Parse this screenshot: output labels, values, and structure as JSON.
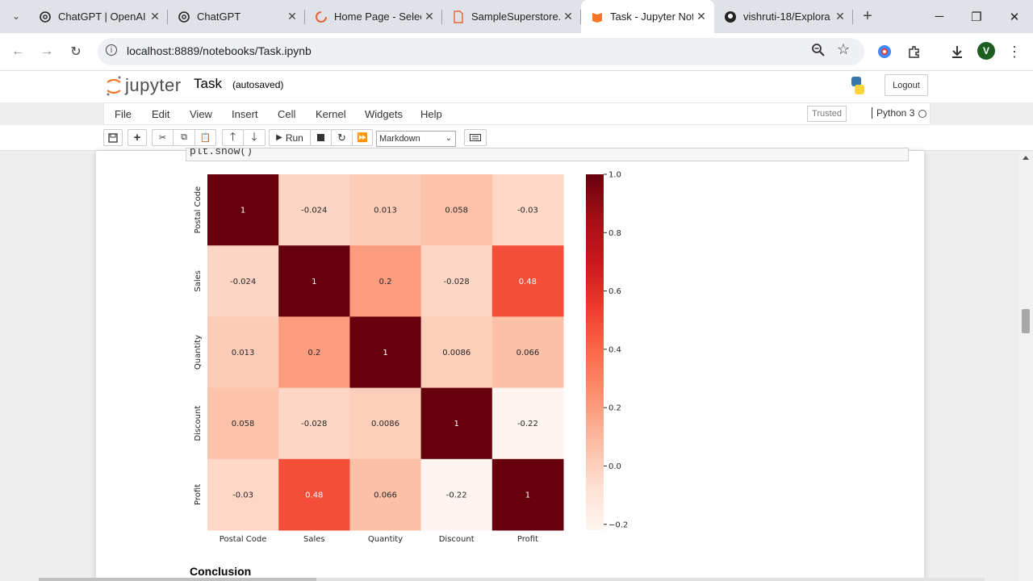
{
  "browser": {
    "tabs": [
      {
        "title": "ChatGPT | OpenAI",
        "icon": "openai-icon",
        "active": false
      },
      {
        "title": "ChatGPT",
        "icon": "openai-icon",
        "active": false
      },
      {
        "title": "Home Page - Selec",
        "icon": "loading-spinner-icon",
        "active": false
      },
      {
        "title": "SampleSuperstore.",
        "icon": "file-icon",
        "active": false
      },
      {
        "title": "Task - Jupyter Note",
        "icon": "jupyter-book-icon",
        "active": true
      },
      {
        "title": "vishruti-18/Explora",
        "icon": "github-icon",
        "active": false
      }
    ],
    "url": "localhost:8889/notebooks/Task.ipynb",
    "avatar_letter": "V"
  },
  "jupyter": {
    "logo_text": "jupyter",
    "notebook_name": "Task",
    "autosave_status": "(autosaved)",
    "logout_label": "Logout",
    "menus": [
      "File",
      "Edit",
      "View",
      "Insert",
      "Cell",
      "Kernel",
      "Widgets",
      "Help"
    ],
    "trusted_label": "Trusted",
    "kernel_name": "Python 3",
    "run_label": "Run",
    "cell_type": "Markdown"
  },
  "notebook": {
    "code_line": "plt.show()",
    "conclusion_heading": "Conclusion"
  },
  "chart_data": {
    "type": "heatmap",
    "title": "",
    "variables": [
      "Postal Code",
      "Sales",
      "Quantity",
      "Discount",
      "Profit"
    ],
    "matrix": [
      [
        1,
        -0.024,
        0.013,
        0.058,
        -0.03
      ],
      [
        -0.024,
        1,
        0.2,
        -0.028,
        0.48
      ],
      [
        0.013,
        0.2,
        1,
        0.0086,
        0.066
      ],
      [
        0.058,
        -0.028,
        0.0086,
        1,
        -0.22
      ],
      [
        -0.03,
        0.48,
        0.066,
        -0.22,
        1
      ]
    ],
    "cell_labels": [
      [
        "1",
        "-0.024",
        "0.013",
        "0.058",
        "-0.03"
      ],
      [
        "-0.024",
        "1",
        "0.2",
        "-0.028",
        "0.48"
      ],
      [
        "0.013",
        "0.2",
        "1",
        "0.0086",
        "0.066"
      ],
      [
        "0.058",
        "-0.028",
        "0.0086",
        "1",
        "-0.22"
      ],
      [
        "-0.03",
        "0.48",
        "0.066",
        "-0.22",
        "1"
      ]
    ],
    "colormap": "Reds",
    "colorbar": {
      "range": [
        -0.22,
        1.0
      ],
      "ticks": [
        1.0,
        0.8,
        0.6,
        0.4,
        0.2,
        0.0,
        -0.2
      ],
      "tick_labels": [
        "1.0",
        "0.8",
        "0.6",
        "0.4",
        "0.2",
        "0.0",
        "−0.2"
      ]
    }
  }
}
